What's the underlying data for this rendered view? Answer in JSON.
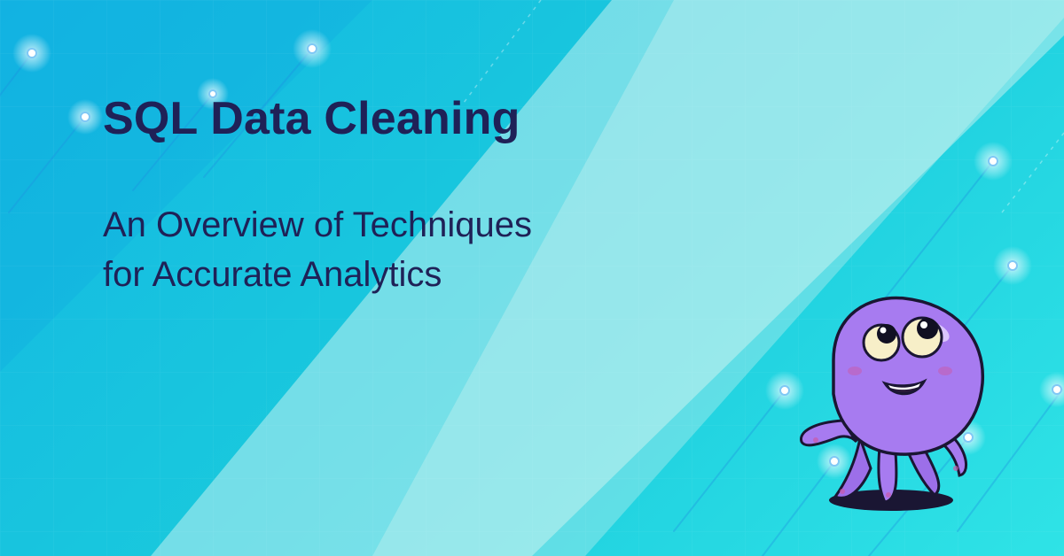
{
  "banner": {
    "title": "SQL Data Cleaning",
    "subtitle_lines": [
      "An Overview of Techniques",
      "for Accurate Analytics"
    ]
  },
  "decor": {
    "background_icon": "diagonal-light-streaks",
    "mascot_icon": "purple-octopus-mascot"
  },
  "colors": {
    "text": "#1f2157",
    "background_start": "#14b7e3",
    "background_end": "#2fe3e6",
    "mascot_body": "#a77bf0",
    "mascot_outline": "#1a1633"
  }
}
